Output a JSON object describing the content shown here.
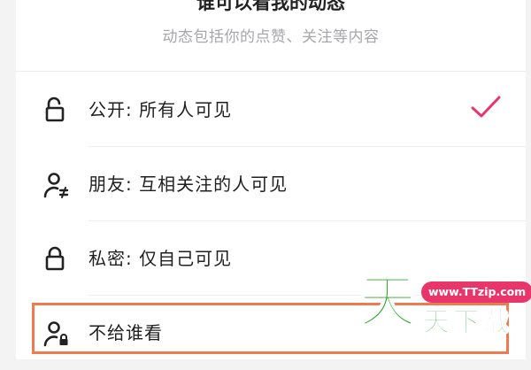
{
  "header": {
    "title": "谁可以看我的动态",
    "subtitle": "动态包括你的点赞、关注等内容"
  },
  "options": [
    {
      "label": "公开: 所有人可见",
      "icon": "unlock-icon",
      "selected": true
    },
    {
      "label": "朋友: 互相关注的人可见",
      "icon": "friends-user-icon",
      "selected": false
    },
    {
      "label": "私密: 仅自己可见",
      "icon": "lock-icon",
      "selected": false
    },
    {
      "label": "不给谁看",
      "icon": "user-lock-icon",
      "selected": false
    }
  ],
  "colors": {
    "accent": "#e8356a",
    "highlight": "#ee7a4e",
    "watermark": "#2aa52a"
  },
  "watermark": {
    "big": "天",
    "url": "www.TTzip.com",
    "small": "天下载"
  }
}
